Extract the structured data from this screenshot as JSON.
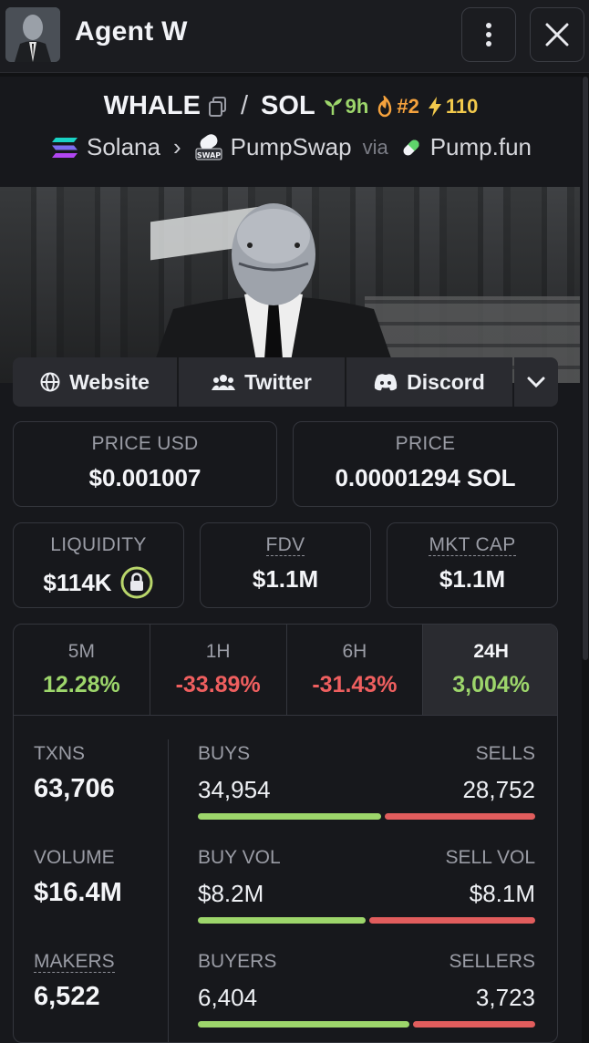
{
  "header": {
    "title": "Agent W"
  },
  "token": {
    "symbol": "WHALE",
    "quote": "SOL",
    "age": "9h",
    "rank": "#2",
    "boosts": "110",
    "chain": "Solana",
    "dex": "PumpSwap",
    "via_label": "via",
    "launchpad": "Pump.fun"
  },
  "links": {
    "website": "Website",
    "twitter": "Twitter",
    "discord": "Discord"
  },
  "prices": {
    "price_usd_label": "PRICE USD",
    "price_usd": "$0.001007",
    "price_label": "PRICE",
    "price": "0.00001294 SOL"
  },
  "metrics": {
    "liquidity_label": "LIQUIDITY",
    "liquidity": "$114K",
    "fdv_label": "FDV",
    "fdv": "$1.1M",
    "mcap_label": "MKT CAP",
    "mcap": "$1.1M"
  },
  "timeframes": [
    {
      "label": "5M",
      "value": "12.28%"
    },
    {
      "label": "1H",
      "value": "-33.89%"
    },
    {
      "label": "6H",
      "value": "-31.43%"
    },
    {
      "label": "24H",
      "value": "3,004%"
    }
  ],
  "stats": {
    "txns_label": "TXNS",
    "txns": "63,706",
    "volume_label": "VOLUME",
    "volume": "$16.4M",
    "makers_label": "MAKERS",
    "makers": "6,522",
    "buys_label": "BUYS",
    "buys": "34,954",
    "sells_label": "SELLS",
    "sells": "28,752",
    "buys_fraction": 0.549,
    "buyvol_label": "BUY VOL",
    "buyvol": "$8.2M",
    "sellvol_label": "SELL VOL",
    "sellvol": "$8.1M",
    "buyvol_fraction": 0.503,
    "buyers_label": "BUYERS",
    "buyers": "6,404",
    "sellers_label": "SELLERS",
    "sellers": "3,723",
    "buyers_fraction": 0.632
  },
  "colors": {
    "positive": "#9dd66b",
    "negative": "#ef5f5f",
    "panel": "#17181c"
  }
}
